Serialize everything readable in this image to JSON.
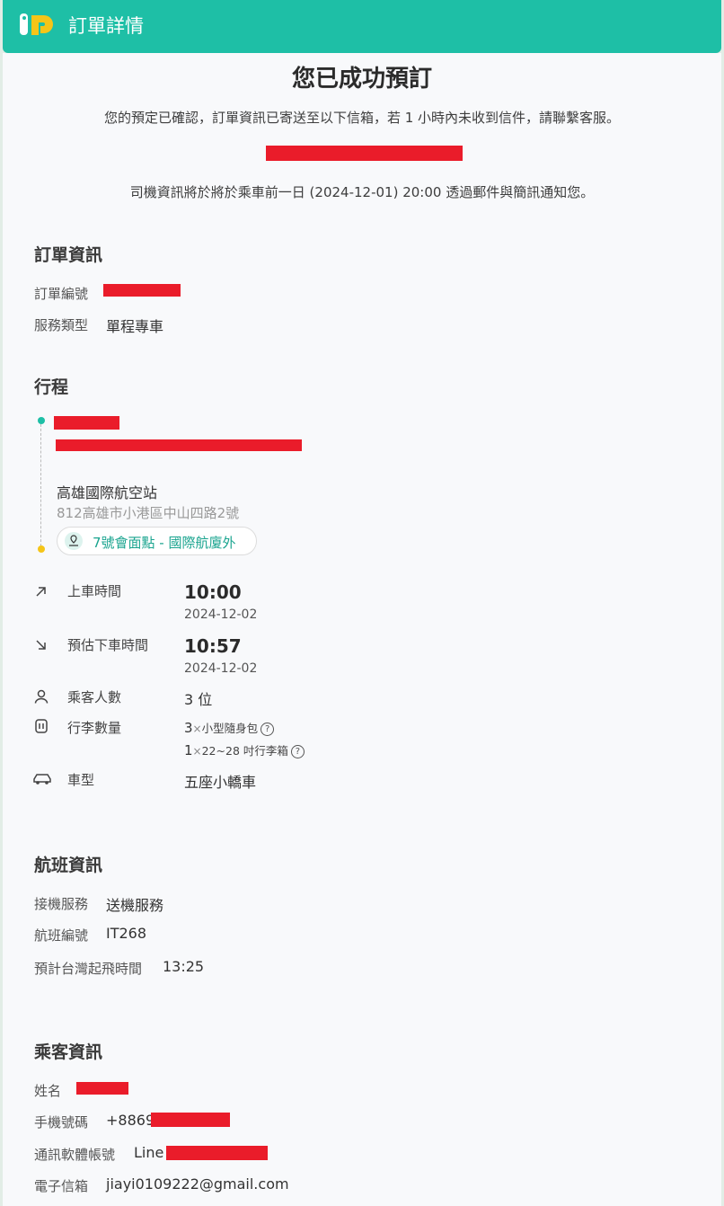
{
  "header": {
    "title": "訂單詳情"
  },
  "confirmation": {
    "title": "您已成功預訂",
    "message": "您的預定已確認，訂單資訊已寄送至以下信箱，若 1 小時內未收到信件，請聯繫客服。",
    "driver_notice": "司機資訊將於將於乘車前一日 (2024-12-01) 20:00 透過郵件與簡訊通知您。"
  },
  "order_info": {
    "title": "訂單資訊",
    "order_number_label": "訂單編號",
    "service_type_label": "服務類型",
    "service_type_value": "單程專車"
  },
  "trip": {
    "title": "行程",
    "dropoff": {
      "name": "高雄國際航空站",
      "address": "812高雄市小港區中山四路2號",
      "meeting_point": "7號會面點 - 國際航廈外"
    },
    "pickup_time": {
      "label": "上車時間",
      "time": "10:00",
      "date": "2024-12-02"
    },
    "dropoff_time": {
      "label": "預估下車時間",
      "time": "10:57",
      "date": "2024-12-02"
    },
    "passengers": {
      "label": "乘客人數",
      "value": "3 位"
    },
    "luggage": {
      "label": "行李數量",
      "items": [
        {
          "count": "3",
          "times": "×",
          "desc": "小型隨身包"
        },
        {
          "count": "1",
          "times": "×",
          "desc": "22~28 吋行李箱"
        }
      ]
    },
    "vehicle": {
      "label": "車型",
      "value": "五座小轎車"
    }
  },
  "flight_info": {
    "title": "航班資訊",
    "service_label": "接機服務",
    "service_value": "送機服務",
    "flight_number_label": "航班編號",
    "flight_number_value": "IT268",
    "departure_label": "預計台灣起飛時間",
    "departure_value": "13:25"
  },
  "passenger_info": {
    "title": "乘客資訊",
    "name_label": "姓名",
    "phone_label": "手機號碼",
    "phone_prefix": "+8869",
    "messenger_label": "通訊軟體帳號",
    "messenger_prefix": "Line",
    "email_label": "電子信箱",
    "email_value": "jiayi0109222@gmail.com"
  },
  "colors": {
    "brand": "#1ebfa6",
    "redaction": "#ea1c2a",
    "timeline_start": "#1ebfa6",
    "timeline_end": "#f5c518",
    "meeting_point_text": "#1aa48f"
  },
  "icons": {
    "logo": "brand-logo",
    "pickup": "arrow-up-right-icon",
    "dropoff": "arrow-down-right-icon",
    "passengers": "person-icon",
    "luggage": "luggage-icon",
    "vehicle": "car-icon",
    "meeting_point": "location-pin-icon",
    "help": "help-circle-icon"
  }
}
